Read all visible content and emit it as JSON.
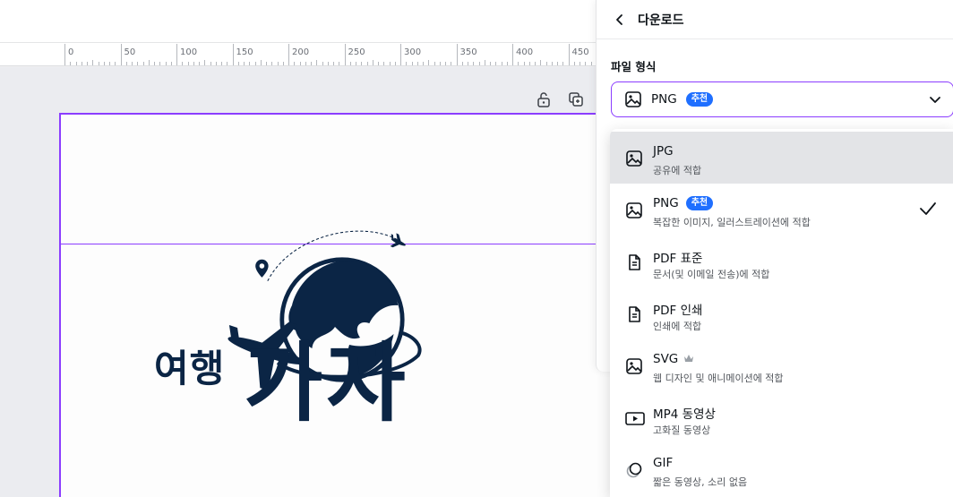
{
  "ruler": {
    "labels": [
      "0",
      "50",
      "100",
      "150",
      "200",
      "250",
      "300",
      "350",
      "400",
      "450"
    ]
  },
  "panel": {
    "title": "다운로드",
    "file_type_label": "파일 형식",
    "selected_format": "PNG",
    "selected_badge": "추천"
  },
  "options": [
    {
      "title": "JPG",
      "desc": "공유에 적합",
      "icon": "image-icon",
      "badge": "",
      "checked": false,
      "hover": true
    },
    {
      "title": "PNG",
      "desc": "복잡한 이미지, 일러스트레이션에 적합",
      "icon": "image-icon",
      "badge": "추천",
      "checked": true,
      "hover": false
    },
    {
      "title": "PDF 표준",
      "desc": "문서(및 이메일 전송)에 적합",
      "icon": "document-icon",
      "badge": "",
      "checked": false,
      "hover": false
    },
    {
      "title": "PDF 인쇄",
      "desc": "인쇄에 적합",
      "icon": "document-icon",
      "badge": "",
      "checked": false,
      "hover": false
    },
    {
      "title": "SVG",
      "desc": "웹 디자인 및 애니메이션에 적합",
      "icon": "image-icon",
      "badge": "",
      "crown": true,
      "checked": false,
      "hover": false
    },
    {
      "title": "MP4 동영상",
      "desc": "고화질 동영상",
      "icon": "video-icon",
      "badge": "",
      "checked": false,
      "hover": false
    },
    {
      "title": "GIF",
      "desc": "짧은 동영상, 소리 없음",
      "icon": "gif-icon",
      "badge": "",
      "checked": false,
      "hover": false
    }
  ],
  "artwork": {
    "text_small": "여행",
    "text_big": "가자"
  },
  "colors": {
    "accent": "#8b3dff",
    "badge": "#1f6fff",
    "artwork_navy": "#0b2545"
  }
}
